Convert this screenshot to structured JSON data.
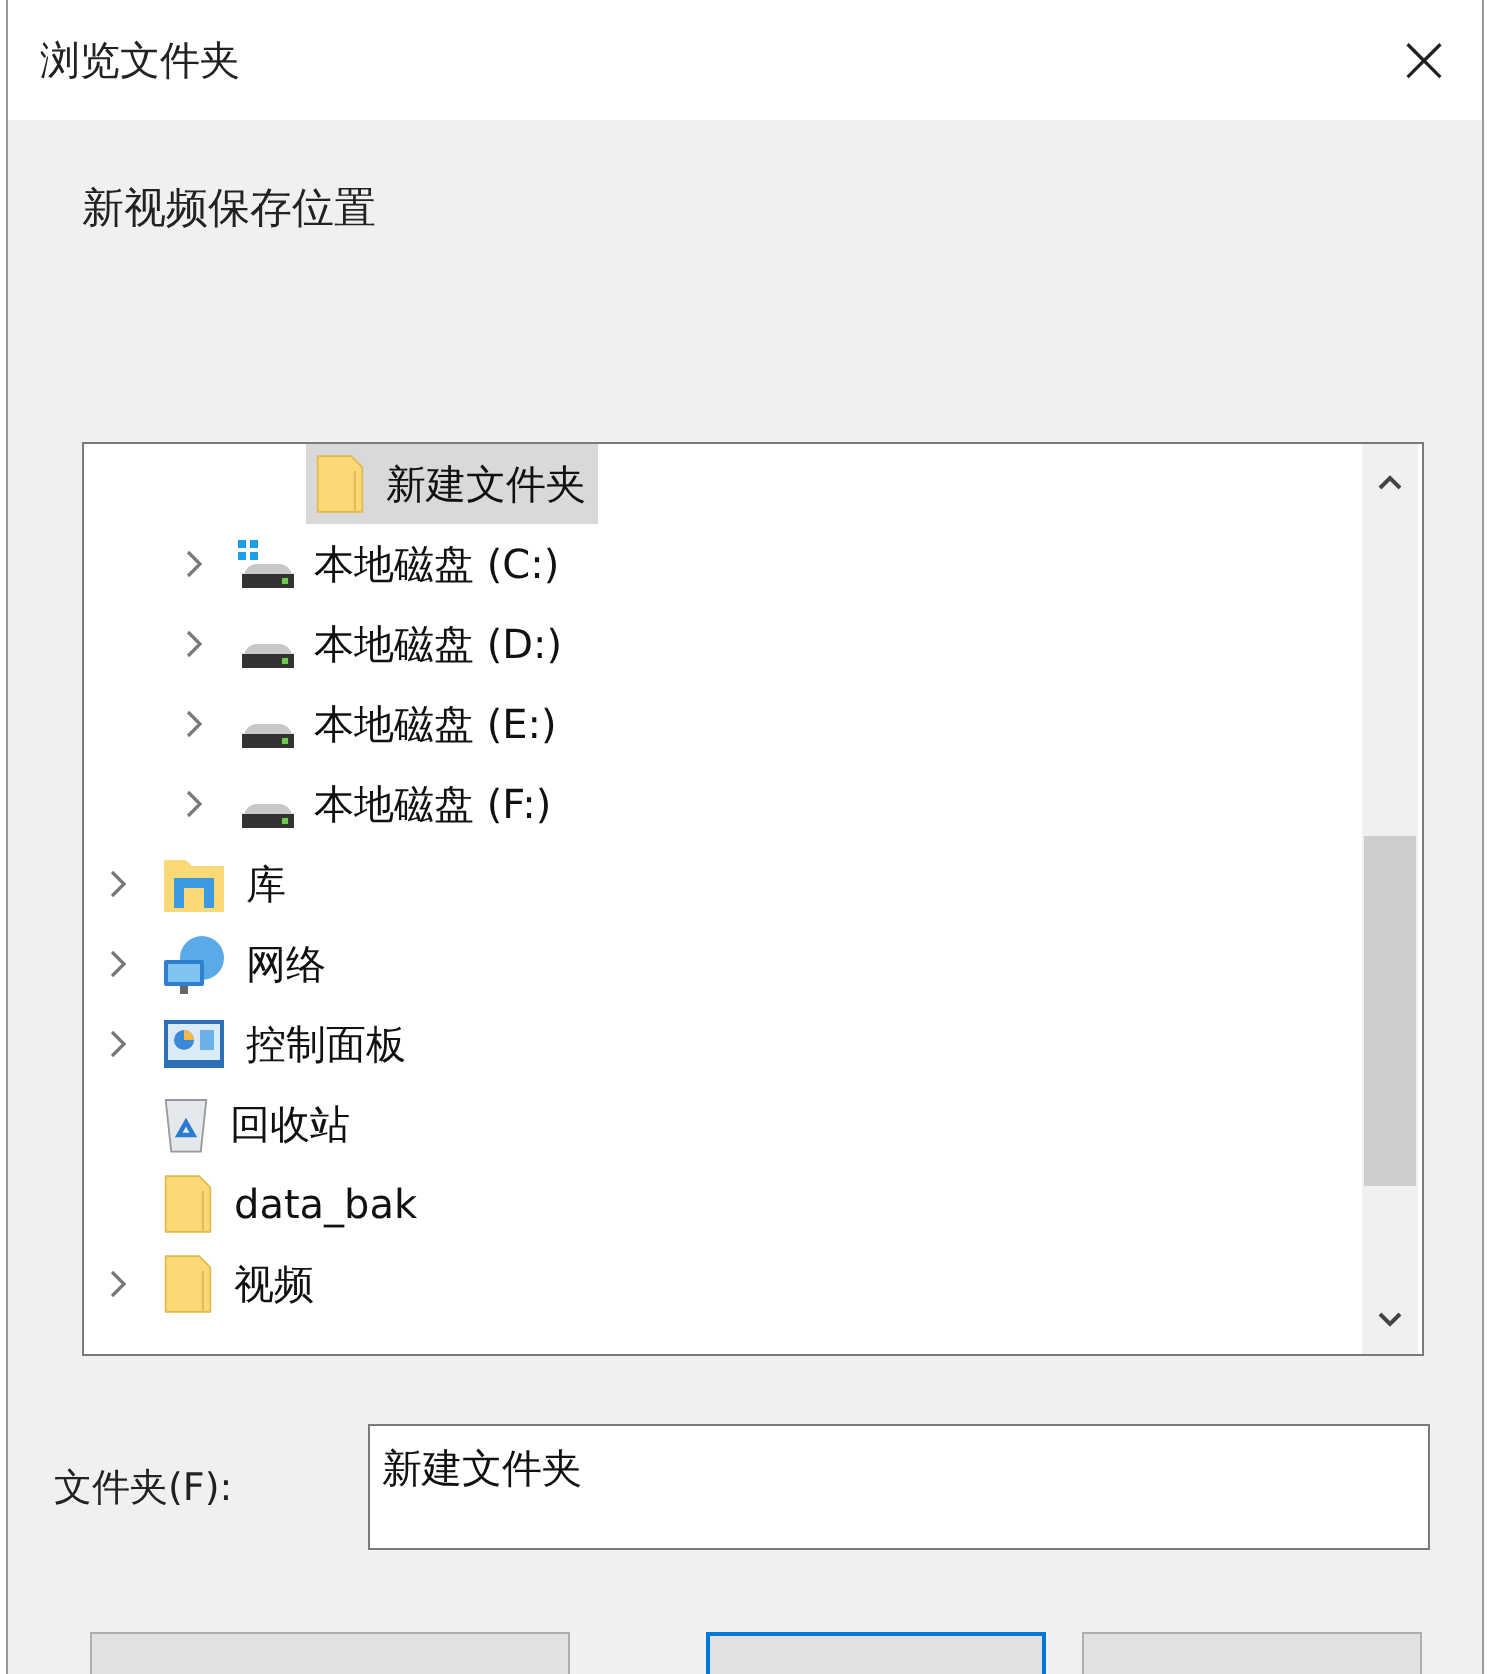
{
  "window": {
    "title": "浏览文件夹",
    "close": "×"
  },
  "description": "新视频保存位置",
  "tree": {
    "items": [
      {
        "children": [
          {
            "children": [
              {
                "label": "新建文件夹",
                "kind": "folder",
                "expandable": false,
                "selected": true
              }
            ]
          },
          {
            "label": "本地磁盘 (C:)",
            "kind": "system-drive",
            "expandable": true,
            "selected": false
          },
          {
            "label": "本地磁盘 (D:)",
            "kind": "drive",
            "expandable": true,
            "selected": false
          },
          {
            "label": "本地磁盘 (E:)",
            "kind": "drive",
            "expandable": true,
            "selected": false
          },
          {
            "label": "本地磁盘 (F:)",
            "kind": "drive",
            "expandable": true,
            "selected": false
          }
        ]
      },
      {
        "label": "库",
        "kind": "library",
        "expandable": true,
        "selected": false
      },
      {
        "label": "网络",
        "kind": "network",
        "expandable": true,
        "selected": false
      },
      {
        "label": "控制面板",
        "kind": "control-panel",
        "expandable": true,
        "selected": false
      },
      {
        "label": "回收站",
        "kind": "recycle-bin",
        "expandable": false,
        "selected": false
      },
      {
        "label": "data_bak",
        "kind": "folder",
        "expandable": false,
        "selected": false
      },
      {
        "label": "视频",
        "kind": "folder",
        "expandable": true,
        "selected": false
      }
    ]
  },
  "folder_field": {
    "label": "文件夹(F):",
    "value": "新建文件夹"
  },
  "buttons": [
    {
      "default": false
    },
    {
      "default": true
    },
    {
      "default": false
    }
  ]
}
